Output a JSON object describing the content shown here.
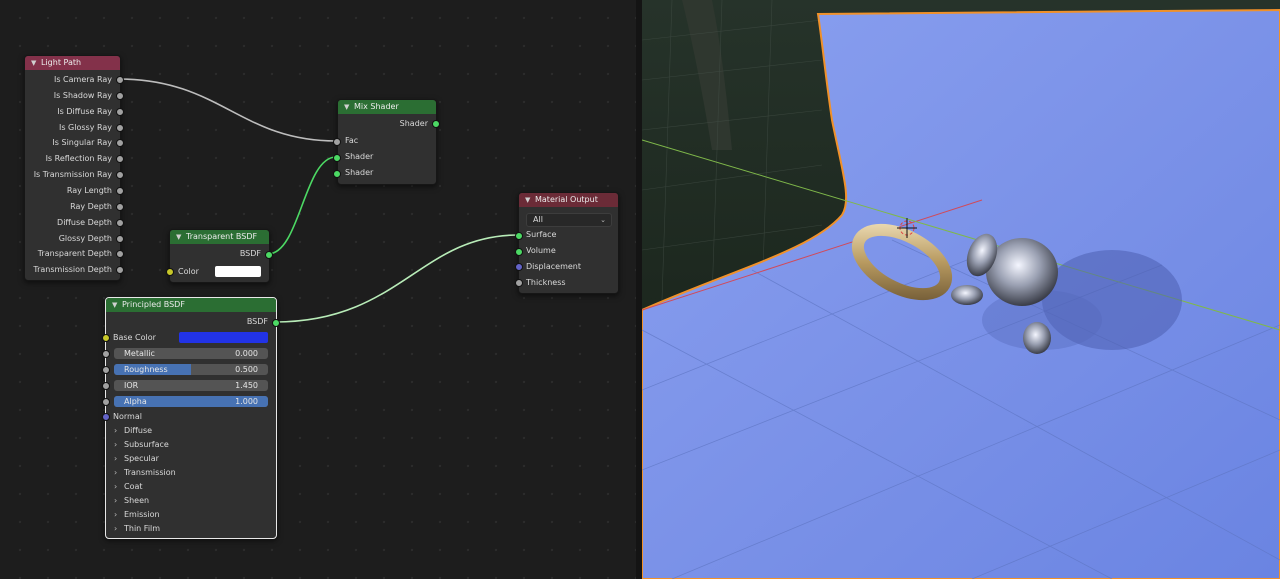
{
  "node_editor": {
    "nodes": {
      "light_path": {
        "title": "Light Path",
        "outputs": [
          "Is Camera Ray",
          "Is Shadow Ray",
          "Is Diffuse Ray",
          "Is Glossy Ray",
          "Is Singular Ray",
          "Is Reflection Ray",
          "Is Transmission Ray",
          "Ray Length",
          "Ray Depth",
          "Diffuse Depth",
          "Glossy Depth",
          "Transparent Depth",
          "Transmission Depth"
        ]
      },
      "mix_shader": {
        "title": "Mix Shader",
        "output": "Shader",
        "inputs": [
          "Fac",
          "Shader",
          "Shader"
        ]
      },
      "transparent_bsdf": {
        "title": "Transparent BSDF",
        "output": "BSDF",
        "color_label": "Color",
        "color_value": "#ffffff"
      },
      "material_output": {
        "title": "Material Output",
        "target": "All",
        "inputs": [
          "Surface",
          "Volume",
          "Displacement",
          "Thickness"
        ]
      },
      "principled_bsdf": {
        "title": "Principled BSDF",
        "output": "BSDF",
        "base_color_label": "Base Color",
        "base_color_value": "#2233e6",
        "fields": [
          {
            "label": "Metallic",
            "value": "0.000",
            "fraction": 0.0
          },
          {
            "label": "Roughness",
            "value": "0.500",
            "fraction": 0.5
          },
          {
            "label": "IOR",
            "value": "1.450",
            "fraction": 0.0
          },
          {
            "label": "Alpha",
            "value": "1.000",
            "fraction": 1.0
          }
        ],
        "normal_label": "Normal",
        "panels": [
          "Diffuse",
          "Subsurface",
          "Specular",
          "Transmission",
          "Coat",
          "Sheen",
          "Emission",
          "Thin Film"
        ]
      }
    }
  },
  "colors": {
    "header_input": "#83314a",
    "header_shader": "#2b6e33",
    "header_output": "#6b2b37",
    "socket_shader": "#4cd964",
    "socket_float": "#a1a1a1",
    "socket_color": "#c7c729",
    "socket_vector": "#6363c7",
    "viewport_plane": "#7b92e8",
    "selection_outline": "#f0912a"
  }
}
